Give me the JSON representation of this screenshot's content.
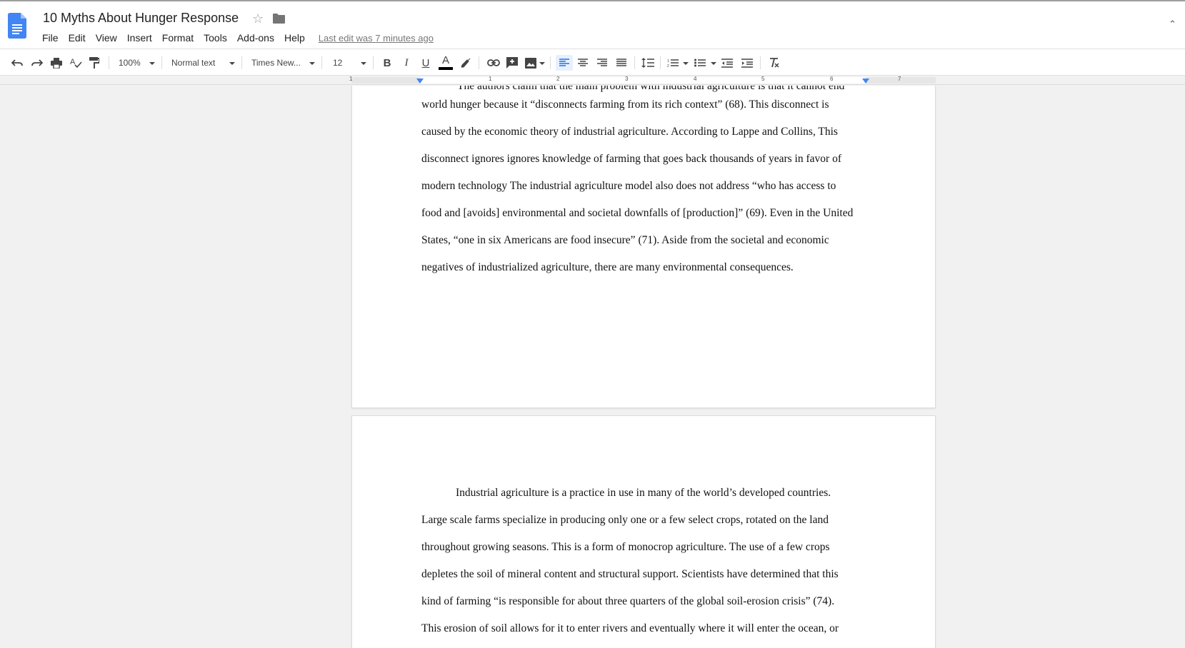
{
  "app": {
    "title": "10 Myths About Hunger Response",
    "last_edit": "Last edit was 7 minutes ago",
    "menu": [
      "File",
      "Edit",
      "View",
      "Insert",
      "Format",
      "Tools",
      "Add-ons",
      "Help"
    ],
    "accent_color": "#4285f4"
  },
  "toolbar": {
    "zoom": "100%",
    "style": "Normal text",
    "font": "Times New...",
    "font_size": "12",
    "icons": [
      "undo-icon",
      "redo-icon",
      "print-icon",
      "spellcheck-icon",
      "paint-format-icon",
      "bold-icon",
      "italic-icon",
      "underline-icon",
      "text-color-icon",
      "highlight-icon",
      "link-icon",
      "comment-icon",
      "image-icon",
      "align-left-icon",
      "align-center-icon",
      "align-right-icon",
      "justify-icon",
      "line-spacing-icon",
      "numbered-list-icon",
      "bulleted-list-icon",
      "decrease-indent-icon",
      "increase-indent-icon",
      "clear-formatting-icon"
    ],
    "active_alignment": "left"
  },
  "ruler": {
    "numbers": [
      "1",
      "1",
      "2",
      "3",
      "4",
      "5",
      "6",
      "7"
    ]
  },
  "document": {
    "page1_lines": [
      "The authors claim that the main problem with industrial agriculture is that it cannot end",
      "world hunger because it “disconnects farming from its rich context” (68). This disconnect is",
      "caused by the economic theory of industrial agriculture. According to Lappe and Collins, This",
      "disconnect ignores ignores knowledge of farming that goes back thousands of years in favor of",
      "modern technology  The industrial agriculture model also does not address “who has access to",
      "food and [avoids] environmental and societal downfalls of [production]” (69). Even in the United",
      "States, “one in six Americans are food insecure” (71). Aside from the societal and economic",
      "negatives of industrialized agriculture, there are many environmental consequences."
    ],
    "page2_lines": [
      "Industrial agriculture is a practice in use in many of the world’s developed countries.",
      "Large scale farms specialize in producing only one or a few select crops, rotated on the land",
      "throughout growing seasons. This is a form of monocrop agriculture. The use of a few crops",
      "depletes the soil of mineral content and structural support. Scientists have determined that this",
      "kind of farming “is responsible for about three quarters of the global soil-erosion crisis” (74).",
      "This erosion of soil allows for it to enter rivers and eventually where it will enter the ocean, or"
    ]
  }
}
